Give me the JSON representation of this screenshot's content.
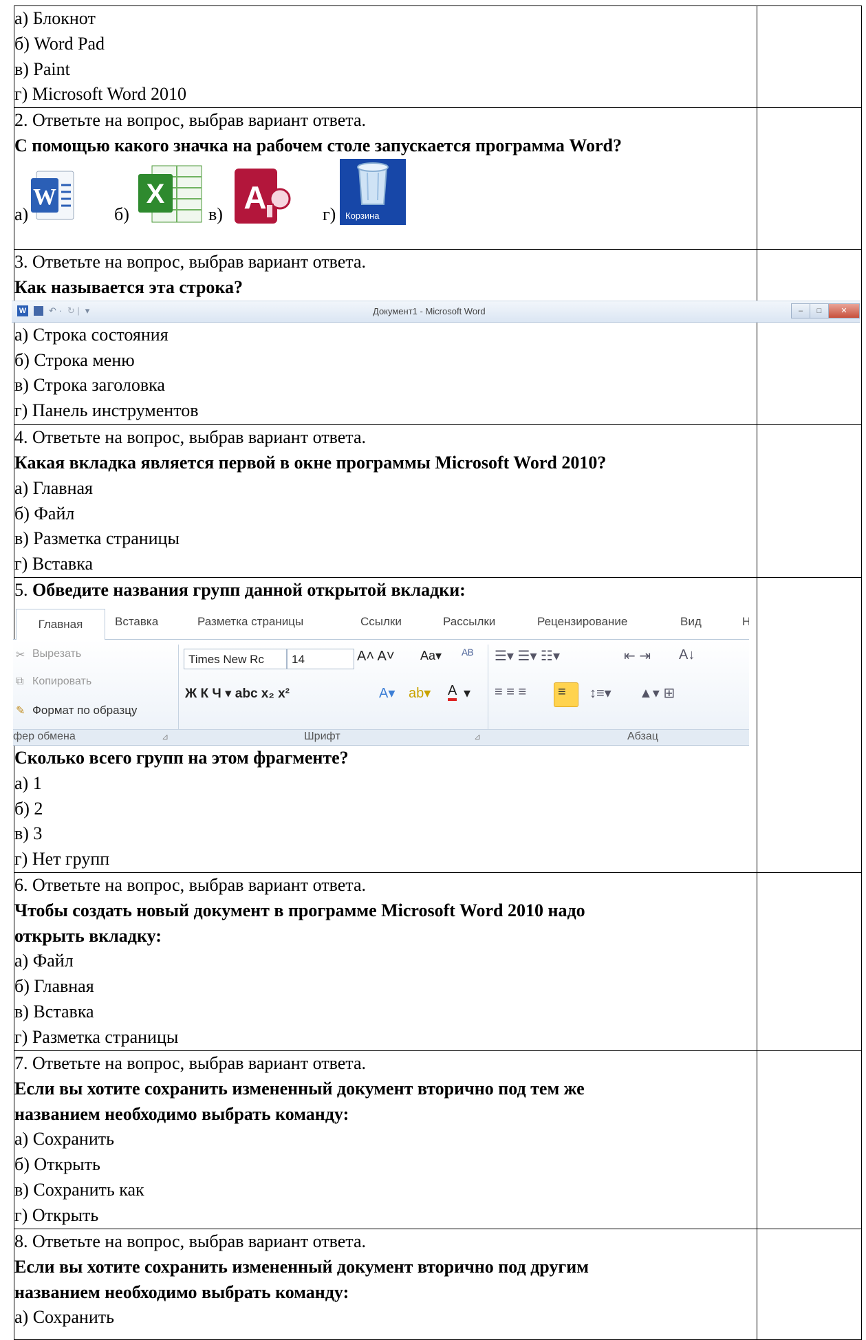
{
  "q1": {
    "options": [
      "а) Блокнот",
      "б) Word Pad",
      "в) Paint",
      "г) Microsoft Word 2010"
    ]
  },
  "q2": {
    "instruction": "2. Ответьте на вопрос, выбрав вариант ответа.",
    "question": "С помощью какого значка на рабочем столе запускается программа Word?",
    "labels": [
      "а)",
      "б)",
      "в)",
      "г)"
    ],
    "recycle_caption": "Корзина"
  },
  "q3": {
    "instruction": "3. Ответьте на вопрос, выбрав вариант ответа.",
    "question": "Как называется эта строка?",
    "window_title": "Документ1 - Microsoft Word",
    "options": [
      "а) Строка состояния",
      "б) Строка меню",
      "в) Строка заголовка",
      "г) Панель инструментов"
    ]
  },
  "q4": {
    "instruction": "4. Ответьте на вопрос, выбрав вариант ответа.",
    "question": "Какая вкладка является первой в окне программы Microsoft Word 2010?",
    "options": [
      "а) Главная",
      "б) Файл",
      "в) Разметка страницы",
      "г) Вставка"
    ]
  },
  "q5": {
    "number": "5.",
    "instruction": "Обведите названия групп данной открытой вкладки:",
    "ribbon": {
      "tabs": [
        "Главная",
        "Вставка",
        "Разметка страницы",
        "Ссылки",
        "Рассылки",
        "Рецензирование",
        "Вид",
        "Н"
      ],
      "clipboard_items": [
        "Вырезать",
        "Копировать",
        "Формат по образцу"
      ],
      "font_name": "Times New Rc",
      "font_size": "14",
      "groups": [
        "фер обмена",
        "Шрифт",
        "Абзац"
      ]
    },
    "question": "Сколько всего групп на этом фрагменте?",
    "options": [
      "а) 1",
      "б) 2",
      "в) 3",
      "г) Нет групп"
    ]
  },
  "q6": {
    "instruction": "6. Ответьте на вопрос, выбрав вариант ответа.",
    "question_lines": [
      "Чтобы создать новый документ в программе Microsoft Word 2010 надо",
      "открыть вкладку:"
    ],
    "options": [
      "а) Файл",
      "б) Главная",
      "в) Вставка",
      "г) Разметка страницы"
    ]
  },
  "q7": {
    "instruction": "7. Ответьте на вопрос, выбрав вариант ответа.",
    "question_lines": [
      "Если вы хотите сохранить измененный документ вторично под тем же",
      "названием необходимо выбрать команду:"
    ],
    "options": [
      "а) Сохранить",
      "б) Открыть",
      "в) Сохранить как",
      "г) Открыть"
    ]
  },
  "q8": {
    "instruction": "8. Ответьте на вопрос, выбрав вариант ответа.",
    "question_lines": [
      "Если вы хотите сохранить измененный документ вторично под другим",
      "названием необходимо выбрать команду:"
    ],
    "options": [
      "а) Сохранить"
    ]
  }
}
